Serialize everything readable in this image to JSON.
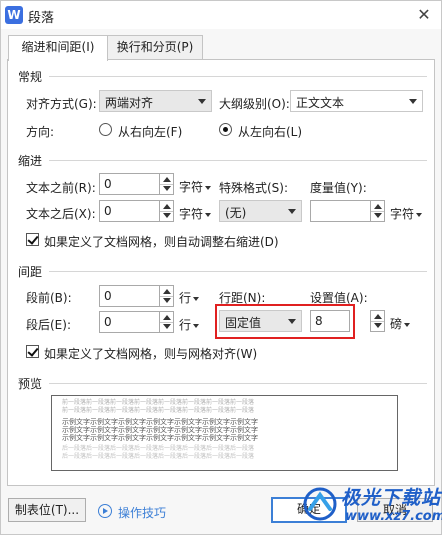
{
  "window": {
    "title": "段落",
    "app_icon_letter": "W",
    "close_symbol": "✕"
  },
  "tabs": [
    {
      "label": "缩进和间距(I)",
      "active": true
    },
    {
      "label": "换行和分页(P)",
      "active": false
    }
  ],
  "general": {
    "section_title": "常规",
    "alignment_label": "对齐方式(G):",
    "alignment_value": "两端对齐",
    "outline_label": "大纲级别(O):",
    "outline_value": "正文文本",
    "direction_label": "方向:",
    "rtl_label": "从右向左(F)",
    "ltr_label": "从左向右(L)",
    "direction_selected": "ltr"
  },
  "indent": {
    "section_title": "缩进",
    "before_label": "文本之前(R):",
    "before_value": "0",
    "before_unit": "字符",
    "after_label": "文本之后(X):",
    "after_value": "0",
    "after_unit": "字符",
    "special_label": "特殊格式(S):",
    "special_value": "(无)",
    "measure_label": "度量值(Y):",
    "measure_value": "",
    "measure_unit": "字符",
    "grid_checkbox_label": "如果定义了文档网格，则自动调整右缩进(D)",
    "grid_checked": true
  },
  "spacing": {
    "section_title": "间距",
    "before_label": "段前(B):",
    "before_value": "0",
    "before_unit": "行",
    "after_label": "段后(E):",
    "after_value": "0",
    "after_unit": "行",
    "line_label": "行距(N):",
    "line_value": "固定值",
    "setting_label": "设置值(A):",
    "setting_value": "8",
    "setting_unit": "磅",
    "grid_checkbox_label": "如果定义了文档网格，则与网格对齐(W)",
    "grid_checked": true
  },
  "preview": {
    "section_title": "预览",
    "sample_text_before": "前一段落前一段落前一段落前一段落前一段落前一段落前一段落前一段落",
    "sample_text_current": "示例文字示例文字示例文字示例文字示例文字示例文字示例文字",
    "sample_text_after": "后一段落后一段落后一段落后一段落后一段落后一段落后一段落后一段落"
  },
  "footer": {
    "tabs_button": "制表位(T)...",
    "tips_link": "操作技巧",
    "ok_button": "确定",
    "cancel_button": "取消"
  },
  "watermark": {
    "brand": "极光下载站",
    "url": "www.xz7.com"
  },
  "colors": {
    "highlight": "#e02020",
    "accent": "#3c7fd6",
    "app_icon": "#3b6fe0"
  }
}
